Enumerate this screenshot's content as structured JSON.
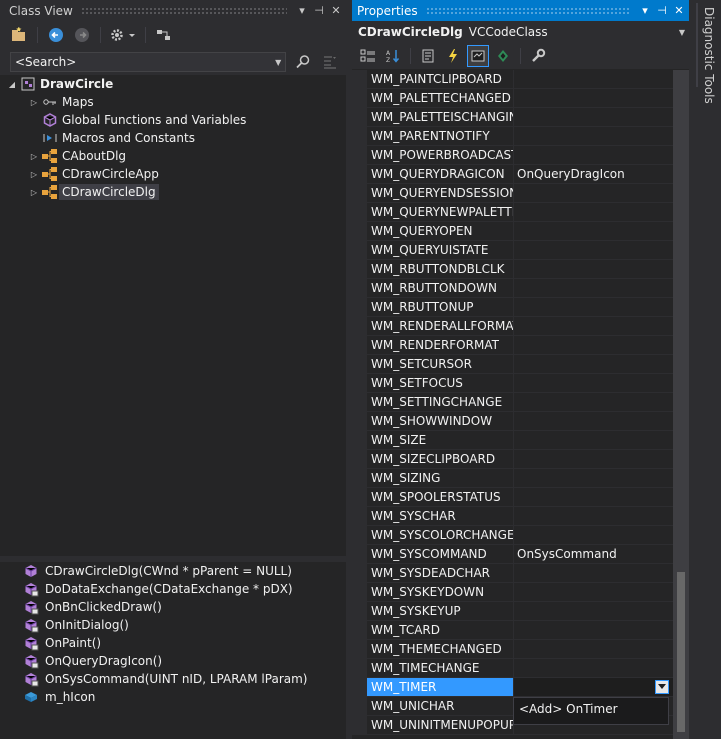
{
  "class_view": {
    "title": "Class View",
    "title_buttons": [
      "▾",
      "⊣",
      "✕"
    ],
    "search_placeholder": "<Search>",
    "tree": [
      {
        "label": "DrawCircle",
        "icon": "project-icon",
        "expander": "◢",
        "bold": true,
        "indent": 0
      },
      {
        "label": "Maps",
        "icon": "map-icon",
        "expander": "▷",
        "indent": 1
      },
      {
        "label": "Global Functions and Variables",
        "icon": "global-icon",
        "expander": "",
        "indent": 1
      },
      {
        "label": "Macros and Constants",
        "icon": "macro-icon",
        "expander": "",
        "indent": 1
      },
      {
        "label": "CAboutDlg",
        "icon": "class-icon",
        "expander": "▷",
        "indent": 1
      },
      {
        "label": "CDrawCircleApp",
        "icon": "class-icon",
        "expander": "▷",
        "indent": 1
      },
      {
        "label": "CDrawCircleDlg",
        "icon": "class-icon",
        "expander": "▷",
        "indent": 1,
        "selected": true
      }
    ],
    "members": [
      {
        "label": "CDrawCircleDlg(CWnd * pParent = NULL)",
        "icon": "method-icon"
      },
      {
        "label": "DoDataExchange(CDataExchange * pDX)",
        "icon": "method-protected-icon"
      },
      {
        "label": "OnBnClickedDraw()",
        "icon": "method-protected-icon"
      },
      {
        "label": "OnInitDialog()",
        "icon": "method-protected-icon"
      },
      {
        "label": "OnPaint()",
        "icon": "method-protected-icon"
      },
      {
        "label": "OnQueryDragIcon()",
        "icon": "method-protected-icon"
      },
      {
        "label": "OnSysCommand(UINT nID, LPARAM lParam)",
        "icon": "method-protected-icon"
      },
      {
        "label": "m_hIcon",
        "icon": "field-icon"
      }
    ]
  },
  "properties": {
    "title": "Properties",
    "title_buttons": [
      "▾",
      "⊣",
      "✕"
    ],
    "object_name": "CDrawCircleDlg",
    "object_type": "VCCodeClass",
    "rows": [
      {
        "name": "WM_PAINTCLIPBOARD",
        "value": ""
      },
      {
        "name": "WM_PALETTECHANGED",
        "value": ""
      },
      {
        "name": "WM_PALETTEISCHANGING",
        "value": ""
      },
      {
        "name": "WM_PARENTNOTIFY",
        "value": ""
      },
      {
        "name": "WM_POWERBROADCAST",
        "value": ""
      },
      {
        "name": "WM_QUERYDRAGICON",
        "value": "OnQueryDragIcon"
      },
      {
        "name": "WM_QUERYENDSESSION",
        "value": ""
      },
      {
        "name": "WM_QUERYNEWPALETTE",
        "value": ""
      },
      {
        "name": "WM_QUERYOPEN",
        "value": ""
      },
      {
        "name": "WM_QUERYUISTATE",
        "value": ""
      },
      {
        "name": "WM_RBUTTONDBLCLK",
        "value": ""
      },
      {
        "name": "WM_RBUTTONDOWN",
        "value": ""
      },
      {
        "name": "WM_RBUTTONUP",
        "value": ""
      },
      {
        "name": "WM_RENDERALLFORMATS",
        "value": ""
      },
      {
        "name": "WM_RENDERFORMAT",
        "value": ""
      },
      {
        "name": "WM_SETCURSOR",
        "value": ""
      },
      {
        "name": "WM_SETFOCUS",
        "value": ""
      },
      {
        "name": "WM_SETTINGCHANGE",
        "value": ""
      },
      {
        "name": "WM_SHOWWINDOW",
        "value": ""
      },
      {
        "name": "WM_SIZE",
        "value": ""
      },
      {
        "name": "WM_SIZECLIPBOARD",
        "value": ""
      },
      {
        "name": "WM_SIZING",
        "value": ""
      },
      {
        "name": "WM_SPOOLERSTATUS",
        "value": ""
      },
      {
        "name": "WM_SYSCHAR",
        "value": ""
      },
      {
        "name": "WM_SYSCOLORCHANGE",
        "value": ""
      },
      {
        "name": "WM_SYSCOMMAND",
        "value": "OnSysCommand"
      },
      {
        "name": "WM_SYSDEADCHAR",
        "value": ""
      },
      {
        "name": "WM_SYSKEYDOWN",
        "value": ""
      },
      {
        "name": "WM_SYSKEYUP",
        "value": ""
      },
      {
        "name": "WM_TCARD",
        "value": ""
      },
      {
        "name": "WM_THEMECHANGED",
        "value": ""
      },
      {
        "name": "WM_TIMECHANGE",
        "value": ""
      },
      {
        "name": "WM_TIMER",
        "value": "",
        "selected": true
      },
      {
        "name": "WM_UNICHAR",
        "value": ""
      },
      {
        "name": "WM_UNINITMENUPOPUP",
        "value": ""
      }
    ],
    "dropdown_options": [
      "<Add> OnTimer"
    ]
  },
  "side_tab": {
    "label": "Diagnostic Tools"
  },
  "colors": {
    "accent": "#007acc",
    "selection": "#3399ff",
    "background": "#252526"
  }
}
